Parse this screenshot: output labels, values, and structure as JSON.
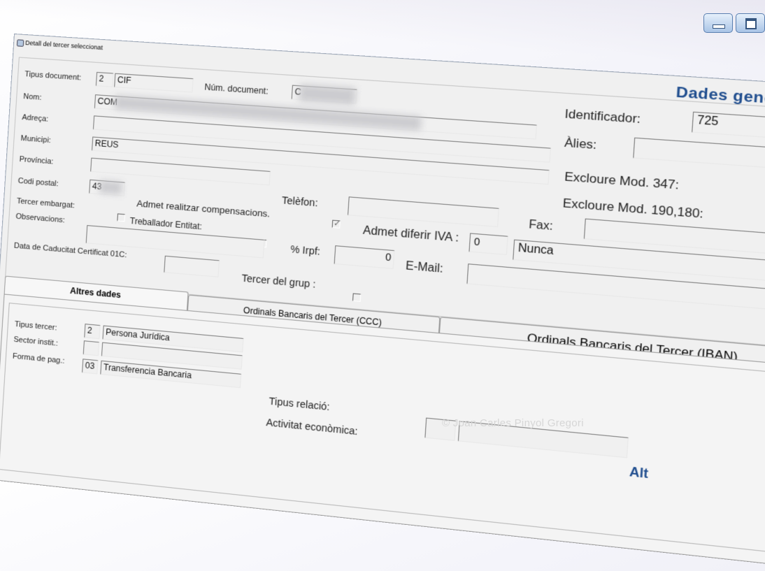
{
  "window": {
    "title": "Detall del tercer seleccionat",
    "header": "Dades gener"
  },
  "general": {
    "tipus_document": {
      "label": "Tipus document:",
      "code": "2",
      "value": "CIF"
    },
    "num_document": {
      "label": "Núm. document:",
      "value": "C"
    },
    "identificador": {
      "label": "Identificador:",
      "value": "725"
    },
    "nom": {
      "label": "Nom:",
      "value": "COM"
    },
    "alies": {
      "label": "Àlies:",
      "value": ""
    },
    "adreca": {
      "label": "Adreça:",
      "value": ""
    },
    "municipi": {
      "label": "Municipi:",
      "value": "REUS"
    },
    "excloure_347": {
      "label": "Excloure Mod. 347:",
      "checked": false
    },
    "provincia": {
      "label": "Província:",
      "value": ""
    },
    "excloure_190": {
      "label": "Excloure Mod. 190,180:",
      "checked": false
    },
    "codi_postal": {
      "label": "Codi postal:",
      "value": "43"
    },
    "telefon": {
      "label": "Telèfon:",
      "value": ""
    },
    "fax": {
      "label": "Fax:",
      "value": ""
    },
    "admet_compensacions": {
      "label": "Admet realitzar compensacions.",
      "checked": true
    },
    "tercer_embargat": {
      "label": "Tercer embargat:",
      "checked": false
    },
    "admet_diferir_iva": {
      "label": "Admet diferir IVA :",
      "code": "0",
      "value": "Nunca"
    },
    "treballador_entitat": {
      "label": "Treballador Entitat:",
      "checked": false
    },
    "observacions": {
      "label": "Observacions:",
      "value": ""
    },
    "irpf": {
      "label": "% Irpf:",
      "value": "0"
    },
    "email": {
      "label": "E-Mail:",
      "value": ""
    },
    "data_caducitat": {
      "label": "Data de Caducitat Certificat 01C:",
      "value": ""
    },
    "tercer_grup": {
      "label": "Tercer del grup :",
      "checked": false
    }
  },
  "tabs": [
    {
      "label": "Altres dades",
      "active": true
    },
    {
      "label": "Ordinals Bancaris del Tercer (CCC)",
      "active": false
    },
    {
      "label": "Ordinals Bancaris del Tercer (IBAN)",
      "active": false
    }
  ],
  "altres": {
    "tipus_tercer": {
      "label": "Tipus tercer:",
      "code": "2",
      "value": "Persona Jurídica"
    },
    "sector_instit": {
      "label": "Sector instit.:",
      "code": "",
      "value": ""
    },
    "forma_pag": {
      "label": "Forma de pag.:",
      "code": "03",
      "value": "Transferencia Bancaria"
    },
    "tipus_relacio": {
      "label": "Tipus relació:"
    },
    "activitat_economica": {
      "label": "Activitat econòmica:"
    },
    "alt_tail": "Alt"
  },
  "watermark": "© Joan Carles Pinyol Gregori",
  "colors": {
    "accent": "#1f4d8e",
    "arrow": "#7b2d8e"
  }
}
